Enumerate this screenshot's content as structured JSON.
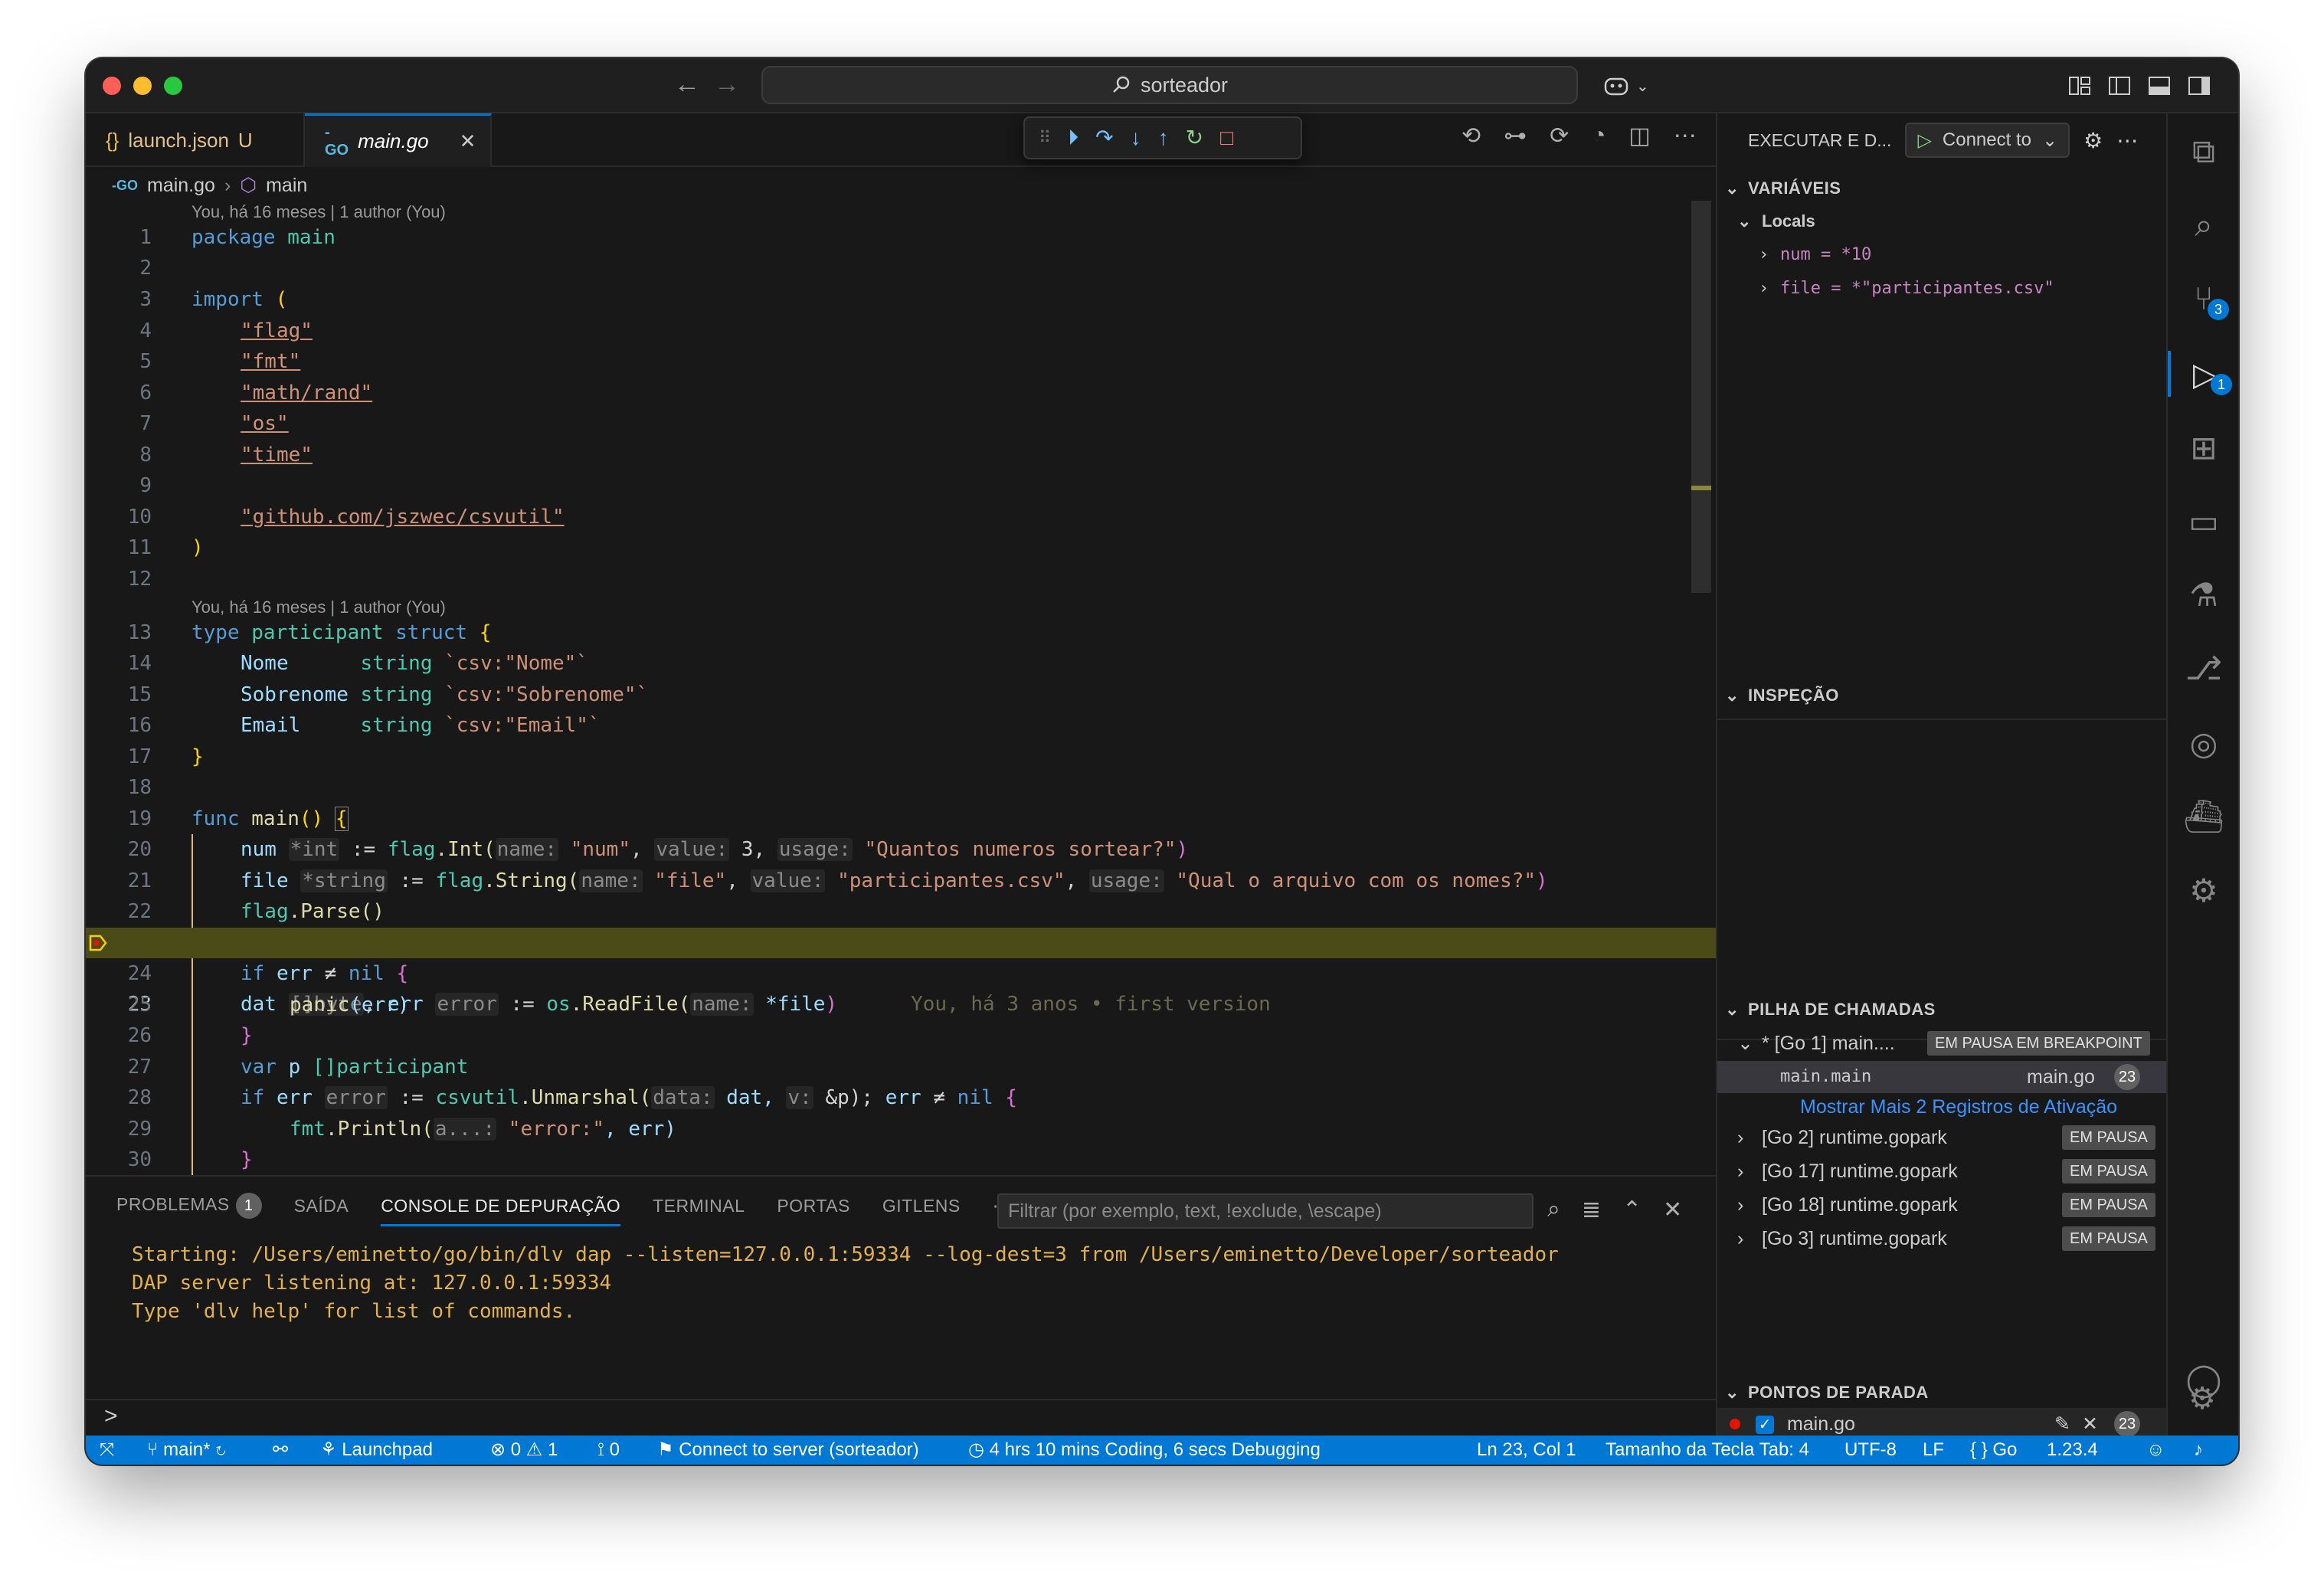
{
  "window": {
    "search_text": "sorteador"
  },
  "tabs": [
    {
      "icon": "{}",
      "label": "launch.json",
      "status": "U"
    },
    {
      "icon": "-GO",
      "label": "main.go"
    }
  ],
  "breadcrumb": {
    "file": "main.go",
    "symbol": "main"
  },
  "codelens": {
    "first": "You, há 16 meses | 1 author (You)",
    "second": "You, há 16 meses | 1 author (You)"
  },
  "editor": {
    "blame_23": "You, há 3 anos • first version",
    "line_numbers": [
      "1",
      "2",
      "3",
      "4",
      "5",
      "6",
      "7",
      "8",
      "9",
      "10",
      "11",
      "12",
      "13",
      "14",
      "15",
      "16",
      "17",
      "18",
      "19",
      "20",
      "21",
      "22",
      "23",
      "24",
      "25",
      "26",
      "27",
      "28",
      "29",
      "30"
    ],
    "lines": {
      "l1a": "package",
      "l1b": "main",
      "l3a": "import",
      "l3b": "(",
      "l4": "\"flag\"",
      "l5": "\"fmt\"",
      "l6": "\"math/rand\"",
      "l7": "\"os\"",
      "l8": "\"time\"",
      "l10": "\"github.com/jszwec/csvutil\"",
      "l11": ")",
      "l13a": "type",
      "l13b": "participant",
      "l13c": "struct",
      "l13d": "{",
      "l14a": "Nome      ",
      "l14b": "string",
      "l14c": "`csv:\"Nome\"`",
      "l15a": "Sobrenome ",
      "l15b": "string",
      "l15c": "`csv:\"Sobrenome\"`",
      "l16a": "Email     ",
      "l16b": "string",
      "l16c": "`csv:\"Email\"`",
      "l17": "}",
      "l19a": "func",
      "l19b": "main",
      "l19c": "()",
      "l19d": "{",
      "l20a": "num",
      "l20h": "*int",
      "l20b": ":=",
      "l20c": "flag",
      "l20d": ".Int(",
      "l20h1": "name:",
      "l20e": "\"num\"",
      "l20h2": "value:",
      "l20f": "3,",
      "l20h3": "usage:",
      "l20g": "\"Quantos numeros sortear?\"",
      "l20z": ")",
      "l21a": "file",
      "l21h": "*string",
      "l21b": ":=",
      "l21c": "flag",
      "l21d": ".String(",
      "l21h1": "name:",
      "l21e": "\"file\"",
      "l21h2": "value:",
      "l21f": "\"participantes.csv\"",
      "l21h3": "usage:",
      "l21g": "\"Qual o arquivo com os nomes?\"",
      "l21z": ")",
      "l22a": "flag",
      "l22b": ".Parse()",
      "l23a": "dat",
      "l23h": "[]byte",
      "l23b": "err",
      "l23h2": "error",
      "l23c": ":=",
      "l23d": "os",
      "l23e": ".ReadFile(",
      "l23h3": "name:",
      "l23f": "*file",
      "l23z": ")",
      "l24a": "if",
      "l24b": "err",
      "l24c": "≠",
      "l24d": "nil",
      "l24e": "{",
      "l25a": "panic",
      "l25b": "(err)",
      "l26": "}",
      "l27a": "var",
      "l27b": "p",
      "l27c": "[]participant",
      "l28a": "if",
      "l28b": "err",
      "l28h": "error",
      "l28c": ":=",
      "l28d": "csvutil",
      "l28e": ".Unmarshal(",
      "l28h1": "data:",
      "l28f": "dat,",
      "l28h2": "v:",
      "l28g": "&p);",
      "l28i": "err",
      "l28j": "≠",
      "l28k": "nil",
      "l28l": "{",
      "l29a": "fmt",
      "l29b": ".Println(",
      "l29h": "a...:",
      "l29c": "\"error:\"",
      "l29d": ", err)",
      "l30": "}"
    }
  },
  "panel": {
    "tabs": [
      "PROBLEMAS",
      "SAÍDA",
      "CONSOLE DE DEPURAÇÃO",
      "TERMINAL",
      "PORTAS",
      "GITLENS"
    ],
    "problems_count": "1",
    "filter_placeholder": "Filtrar (por exemplo, text, !exclude, \\escape)",
    "console_lines": [
      "Starting: /Users/eminetto/go/bin/dlv dap --listen=127.0.0.1:59334 --log-dest=3 from /Users/eminetto/Developer/sorteador",
      "DAP server listening at: 127.0.0.1:59334",
      "Type 'dlv help' for list of commands."
    ],
    "prompt": ">"
  },
  "debug": {
    "title": "EXECUTAR E D...",
    "config": "Connect to",
    "variables": "VARIÁVEIS",
    "locals": "Locals",
    "vars": [
      "num = *10",
      "file = *\"participantes.csv\""
    ],
    "watch": "INSPEÇÃO",
    "callstack": "PILHA DE CHAMADAS",
    "thread1": "* [Go 1] main....",
    "thread1_status": "EM PAUSA EM BREAKPOINT",
    "frame": "main.main",
    "frame_file": "main.go",
    "frame_line": "23",
    "more": "Mostrar Mais 2 Registros de Ativação",
    "threads": [
      {
        "label": "[Go 2] runtime.gopark",
        "status": "EM PAUSA"
      },
      {
        "label": "[Go 17] runtime.gopark",
        "status": "EM PAUSA"
      },
      {
        "label": "[Go 18] runtime.gopark",
        "status": "EM PAUSA"
      },
      {
        "label": "[Go 3] runtime.gopark",
        "status": "EM PAUSA"
      }
    ],
    "breakpoints": "PONTOS DE PARADA",
    "bp_file": "main.go",
    "bp_line": "23"
  },
  "activity": {
    "scm_badge": "3",
    "debug_badge": "1"
  },
  "statusbar": {
    "branch": "main*",
    "launchpad": "Launchpad",
    "problems": "⊗ 0 ⚠ 1",
    "ports": "0",
    "connect": "Connect to server (sorteador)",
    "coding": "4 hrs 10 mins Coding, 6 secs Debugging",
    "position": "Ln 23, Col 1",
    "tab_size": "Tamanho da Tecla Tab: 4",
    "encoding": "UTF-8",
    "eol": "LF",
    "language": "Go",
    "version": "1.23.4"
  },
  "colors": {
    "accent": "#0078d4",
    "background": "#181818",
    "highlight": "#4b4b18",
    "console_text": "#e0b14c"
  }
}
